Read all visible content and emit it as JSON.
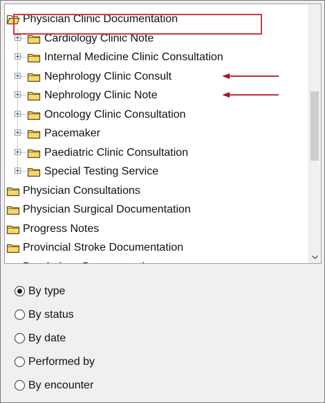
{
  "tree": {
    "items": [
      {
        "label": "Physician Clinic Documentation",
        "level": 0,
        "expanded": true,
        "highlighted": true
      },
      {
        "label": "Cardiology Clinic Note",
        "level": 1
      },
      {
        "label": "Internal Medicine Clinic Consultation",
        "level": 1
      },
      {
        "label": "Nephrology Clinic Consult",
        "level": 1,
        "arrow": true
      },
      {
        "label": "Nephrology Clinic Note",
        "level": 1,
        "arrow": true
      },
      {
        "label": "Oncology Clinic Consultation",
        "level": 1
      },
      {
        "label": "Pacemaker",
        "level": 1
      },
      {
        "label": "Paediatric Clinic Consultation",
        "level": 1
      },
      {
        "label": "Special Testing Service",
        "level": 1
      },
      {
        "label": "Physician Consultations",
        "level": 0
      },
      {
        "label": "Physician Surgical Documentation",
        "level": 0
      },
      {
        "label": "Progress Notes",
        "level": 0
      },
      {
        "label": "Provincial Stroke Documentation",
        "level": 0
      },
      {
        "label": "Psychology Documentation",
        "level": 0,
        "partial": true
      }
    ]
  },
  "view_options": {
    "selected": "By type",
    "items": [
      "By type",
      "By status",
      "By date",
      "Performed by",
      "By encounter"
    ]
  },
  "colors": {
    "folder_fill": "#f6d76b",
    "folder_stroke": "#5a4a12",
    "annotation_red": "#b3131b",
    "highlight_border": "#d0383f"
  }
}
